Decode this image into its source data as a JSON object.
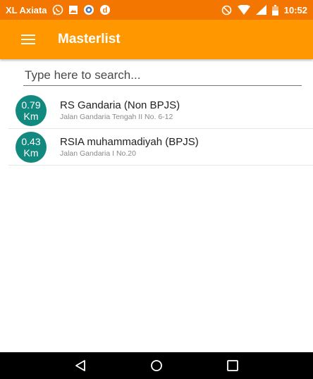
{
  "status_bar": {
    "carrier": "XL Axiata",
    "time": "10:52",
    "icons": [
      "whatsapp-icon",
      "image-icon",
      "globe-icon",
      "dana-icon",
      "do-not-disturb-icon",
      "wifi-icon",
      "signal-icon",
      "battery-icon"
    ]
  },
  "app_bar": {
    "title": "Masterlist",
    "menu_icon": "hamburger-menu-icon",
    "color": "#ff9800"
  },
  "search": {
    "placeholder": "Type here to search...",
    "value": ""
  },
  "list": {
    "items": [
      {
        "distance": "0.79",
        "unit": "Km",
        "title": "RS Gandaria (Non BPJS)",
        "address": "Jalan Gandaria Tengah II No. 6-12"
      },
      {
        "distance": "0.43",
        "unit": "Km",
        "title": "RSIA muhammadiyah (BPJS)",
        "address": "Jalan Gandaria I No.20"
      }
    ],
    "badge_color": "#12897e"
  },
  "nav_bar": {
    "buttons": [
      "back-icon",
      "home-icon",
      "recents-icon"
    ]
  }
}
